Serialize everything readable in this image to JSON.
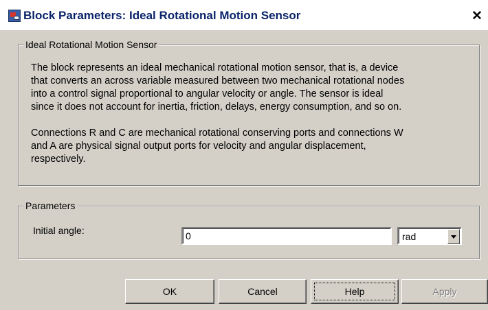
{
  "window": {
    "title": "Block Parameters: Ideal Rotational Motion Sensor",
    "close_glyph": "✕",
    "icon": "block-parameters-icon"
  },
  "description_group": {
    "legend": "Ideal Rotational Motion Sensor",
    "lines": [
      "The block represents an ideal mechanical rotational motion sensor, that is, a device",
      "that converts an across variable measured between two mechanical rotational nodes",
      "into a control signal proportional to angular velocity or angle. The sensor is ideal",
      "since it does not account for inertia, friction, delays, energy consumption, and so on.",
      "",
      "Connections R and C are mechanical rotational conserving ports and connections W",
      "and A are physical signal output ports for velocity and angular displacement,",
      "respectively."
    ]
  },
  "parameters_group": {
    "legend": "Parameters",
    "initial_angle_label": "Initial angle:",
    "initial_angle_value": "0",
    "unit_selected": "rad"
  },
  "buttons": {
    "ok": "OK",
    "cancel": "Cancel",
    "help": "Help",
    "apply": "Apply"
  },
  "colors": {
    "dialog_face": "#d4d0c8",
    "title_text": "#0a246a",
    "disabled_text": "#808080"
  }
}
